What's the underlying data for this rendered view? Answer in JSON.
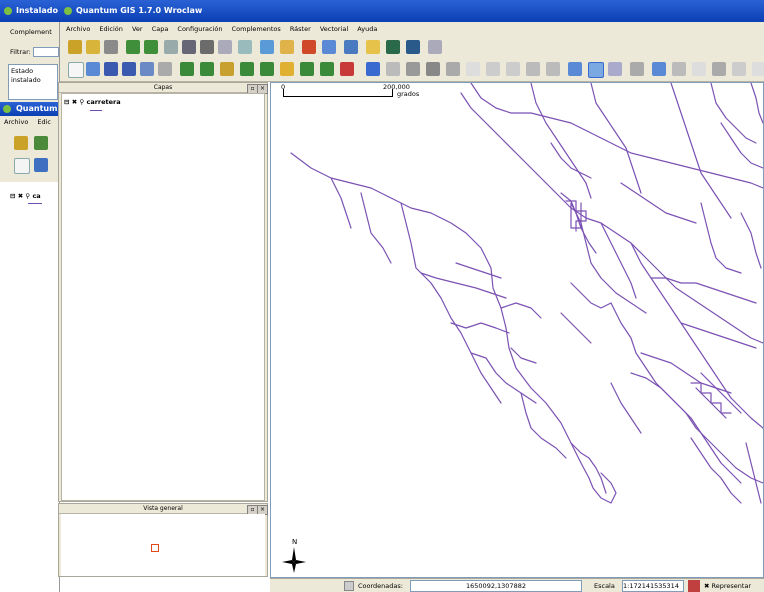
{
  "windows": {
    "plugin_installer_title": "Instalado",
    "qgis_title": "Quantum GIS 1.7.0 Wroclaw",
    "second_qgis_title": "Quantum"
  },
  "plugin_installer": {
    "tab": "Complement",
    "filter_label": "Filtrar:",
    "status_header": "Estado",
    "status_value": "instalado"
  },
  "menus": [
    "Archivo",
    "Edición",
    "Ver",
    "Capa",
    "Configuración",
    "Complementos",
    "Ráster",
    "Vectorial",
    "Ayuda"
  ],
  "second_menus": [
    "Archivo",
    "Edic"
  ],
  "layers_panel": {
    "title": "Capas",
    "layer_name": "carretera"
  },
  "second_layer_name": "ca",
  "overview_panel": {
    "title": "Vista general"
  },
  "scalebar": {
    "start": "0",
    "end": "200,000",
    "units": "grados"
  },
  "north_arrow": "N",
  "statusbar": {
    "coord_label": "Coordenadas:",
    "coord_value": "1650092,1307882",
    "scale_label": "Escala",
    "scale_value": "1:172141535314",
    "render_label": "Representar"
  },
  "colors": {
    "road": "#7b52b3",
    "title_blue": "#0b3fb3",
    "chrome": "#ece9d8"
  }
}
